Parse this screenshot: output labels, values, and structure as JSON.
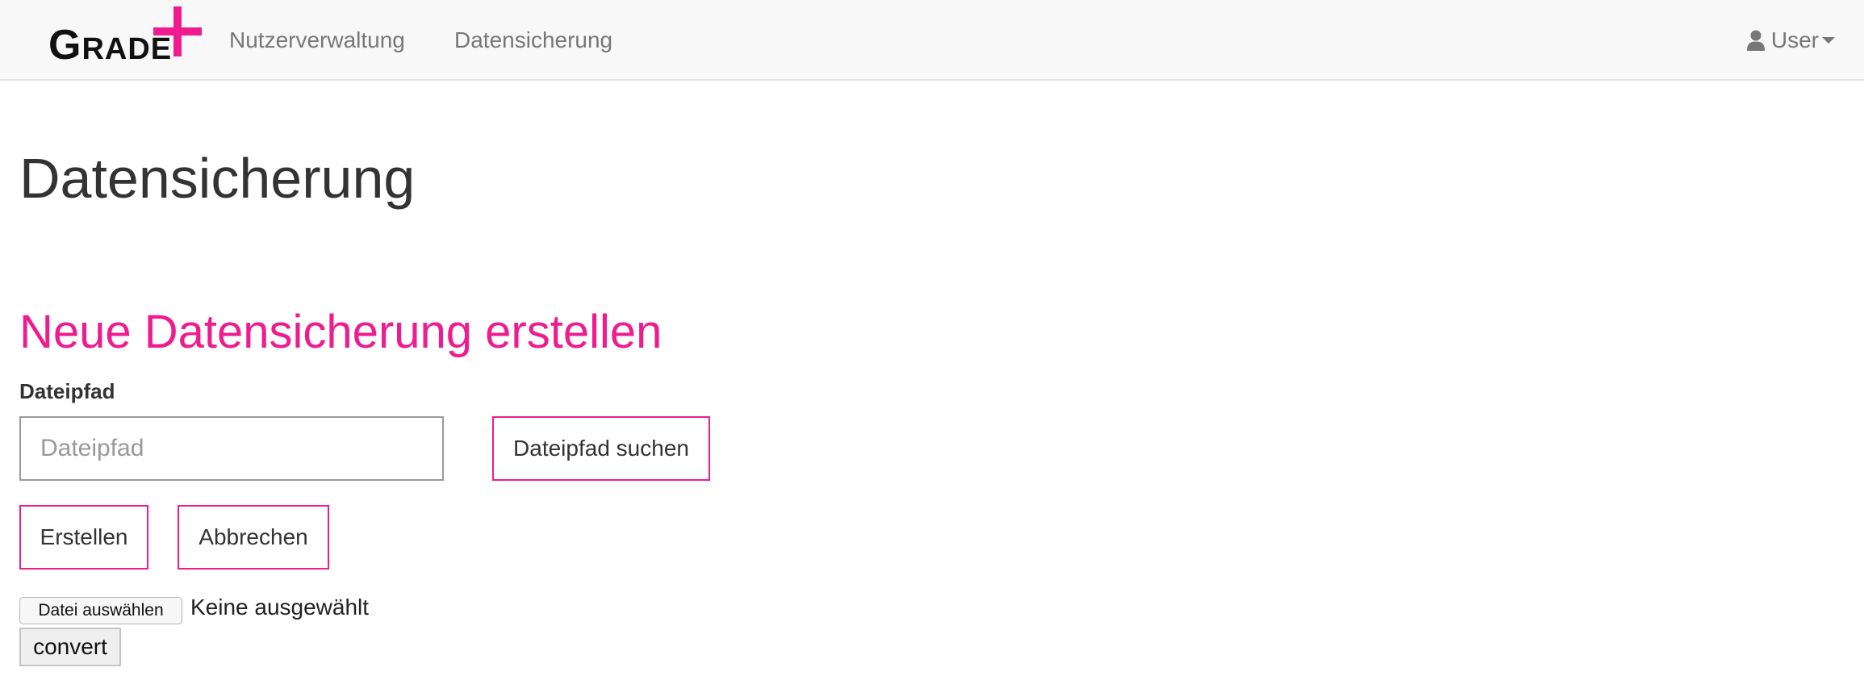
{
  "navbar": {
    "logo": {
      "text_first": "G",
      "text_rest": "RADE",
      "plus_color": "#ee1c8e"
    },
    "links": [
      {
        "label": "Nutzerverwaltung"
      },
      {
        "label": "Datensicherung"
      }
    ],
    "user_menu": {
      "label": "User",
      "icon": "user-icon",
      "dropdown_icon": "caret-down-icon"
    }
  },
  "main": {
    "page_title": "Datensicherung",
    "section_title": "Neue Datensicherung erstellen",
    "path_field": {
      "label": "Dateipfad",
      "placeholder": "Dateipfad",
      "value": ""
    },
    "search_button": "Dateipfad suchen",
    "create_button": "Erstellen",
    "cancel_button": "Abbrechen",
    "file_input": {
      "button_label": "Datei auswählen",
      "status": "Keine ausgewählt"
    },
    "convert_button": "convert"
  },
  "colors": {
    "accent": "#ee1c8e",
    "navbar_bg": "#f8f8f8",
    "text": "#333333",
    "nav_text": "#777777"
  }
}
